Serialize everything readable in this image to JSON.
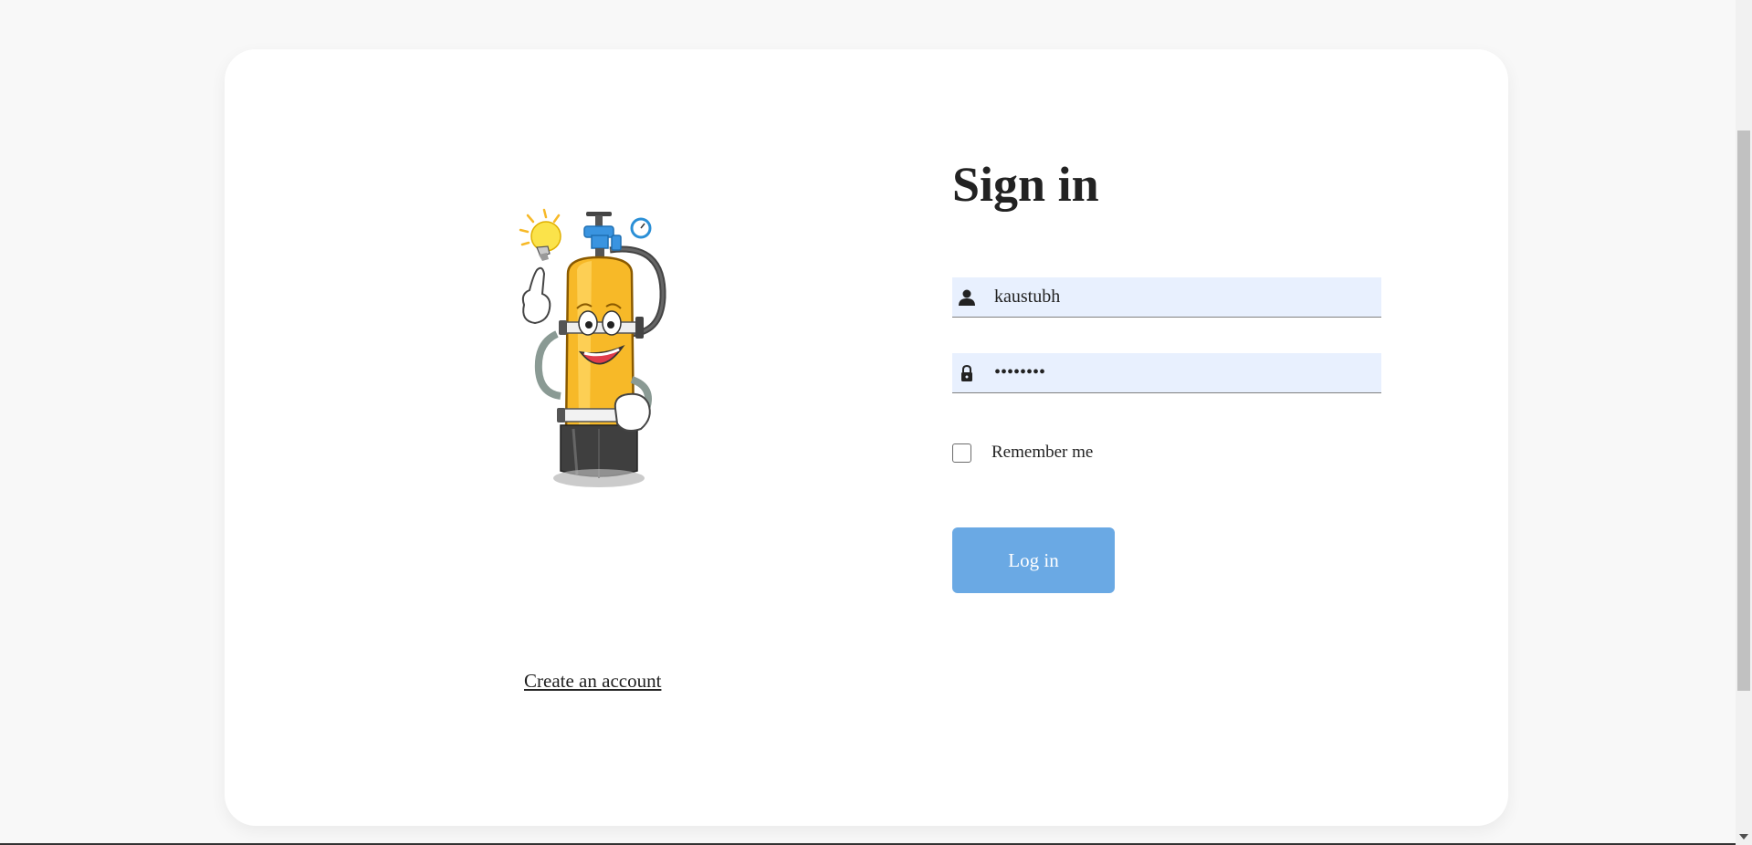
{
  "login": {
    "title": "Sign in",
    "username": {
      "value": "kaustubh",
      "icon": "user-icon"
    },
    "password": {
      "value": "••••••••",
      "icon": "lock-icon"
    },
    "remember_label": "Remember me",
    "remember_checked": false,
    "login_button_label": "Log in"
  },
  "illustration": {
    "name": "scuba-tank-mascot",
    "accent_color": "#f7b928"
  },
  "links": {
    "create_account": "Create an account"
  },
  "colors": {
    "page_background": "#f8f8f8",
    "card_background": "#ffffff",
    "input_background": "#e8f0fe",
    "button_background": "#6aa9e4",
    "button_text": "#ffffff"
  }
}
